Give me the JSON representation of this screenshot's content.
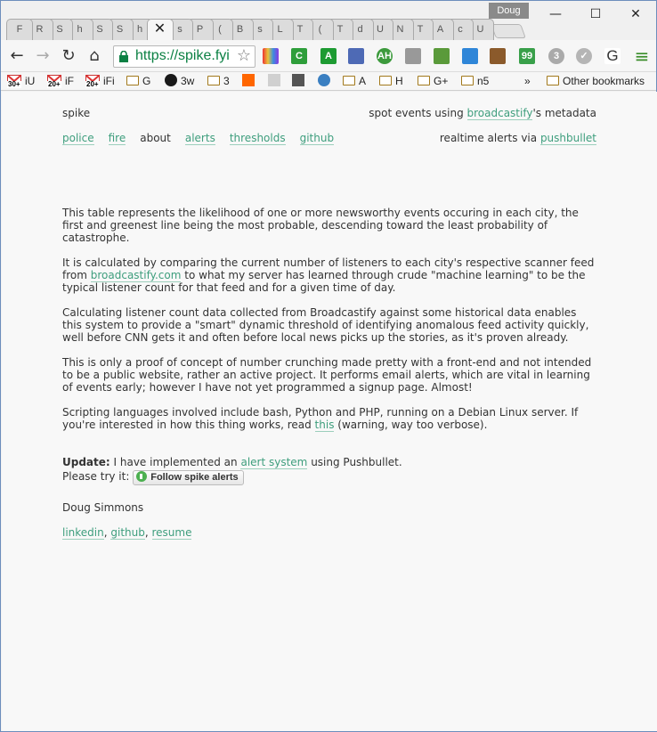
{
  "window": {
    "profile": "Doug",
    "minimize": "—",
    "maximize": "☐",
    "close": "✕"
  },
  "tabs": [
    {
      "label": "F"
    },
    {
      "label": "R"
    },
    {
      "label": "S"
    },
    {
      "label": "h"
    },
    {
      "label": "S"
    },
    {
      "label": "S"
    },
    {
      "label": "h"
    },
    {
      "label": "✕",
      "active": true
    },
    {
      "label": "s"
    },
    {
      "label": "P"
    },
    {
      "label": "("
    },
    {
      "label": "B"
    },
    {
      "label": "s"
    },
    {
      "label": "L"
    },
    {
      "label": "T"
    },
    {
      "label": "("
    },
    {
      "label": "T"
    },
    {
      "label": "d"
    },
    {
      "label": "U"
    },
    {
      "label": "N"
    },
    {
      "label": "T"
    },
    {
      "label": "A"
    },
    {
      "label": "c"
    },
    {
      "label": "U"
    }
  ],
  "toolbar": {
    "back": "←",
    "forward": "→",
    "reload": "↻",
    "home": "⌂",
    "url": "https://spike.fyi",
    "star": "☆",
    "menu": "≡"
  },
  "extensions": [
    {
      "icon": "colorpicker-icon",
      "text": "",
      "color": "#c04a9a"
    },
    {
      "icon": "refresh-green-icon",
      "text": "C",
      "color": "#2e9e3a"
    },
    {
      "icon": "a-green-icon",
      "text": "A",
      "color": "#1d9b32"
    },
    {
      "icon": "flag-icon",
      "text": "",
      "color": "#4e6ab5"
    },
    {
      "icon": "ah-icon",
      "text": "AH",
      "color": "#3c9a3c"
    },
    {
      "icon": "rss-icon",
      "text": "",
      "color": "#999999"
    },
    {
      "icon": "evernote-icon",
      "text": "",
      "color": "#5a9a3a"
    },
    {
      "icon": "drive-icon",
      "text": "",
      "color": "#2f86d8"
    },
    {
      "icon": "monkey-icon",
      "text": "",
      "color": "#8b5a2b"
    },
    {
      "icon": "quote-icon",
      "text": "99",
      "color": "#39a04a"
    },
    {
      "icon": "circle3-icon",
      "text": "3",
      "color": "#aaaaaa"
    },
    {
      "icon": "check-circle-icon",
      "text": "✓",
      "color": "#b5b5b5"
    },
    {
      "icon": "google-g-icon",
      "text": "G",
      "color": "#ffffff"
    }
  ],
  "bookmarks": [
    {
      "label": "iU",
      "icon": "gmail-icon",
      "badge": "30+"
    },
    {
      "label": "iF",
      "icon": "gmail-icon",
      "badge": "20+"
    },
    {
      "label": "iFi",
      "icon": "gmail-icon",
      "badge": "20+"
    },
    {
      "label": "G",
      "icon": "folder-icon"
    },
    {
      "label": "3w",
      "icon": "spiral-icon"
    },
    {
      "label": "3",
      "icon": "folder-icon"
    },
    {
      "label": "",
      "icon": "hn-icon"
    },
    {
      "label": "",
      "icon": "news-icon"
    },
    {
      "label": "",
      "icon": "book-icon"
    },
    {
      "label": "",
      "icon": "signal-icon"
    },
    {
      "label": "A",
      "icon": "folder-icon"
    },
    {
      "label": "H",
      "icon": "folder-icon"
    },
    {
      "label": "G+",
      "icon": "folder-icon"
    },
    {
      "label": "n5",
      "icon": "folder-icon"
    }
  ],
  "bookmarks_more": "»",
  "other_bookmarks": "Other bookmarks",
  "site": {
    "brand": "spike",
    "tagline_pre": "spot events using ",
    "tagline_link": "broadcastify",
    "tagline_post": "'s metadata",
    "nav": [
      {
        "label": "police",
        "link": true
      },
      {
        "label": "fire",
        "link": true
      },
      {
        "label": "about",
        "link": false
      },
      {
        "label": "alerts",
        "link": true
      },
      {
        "label": "thresholds",
        "link": true
      },
      {
        "label": "github",
        "link": true
      }
    ],
    "realtime_pre": "realtime alerts via ",
    "realtime_link": "pushbullet"
  },
  "content": {
    "p1": "This table represents the likelihood of one or more newsworthy events occuring in each city, the first and greenest line being the most probable, descending toward the least probability of catastrophe.",
    "p2_pre": "It is calculated by comparing the current number of listeners to each city's respective scanner feed from ",
    "p2_link": "broadcastify.com",
    "p2_post": " to what my server has learned through crude \"machine learning\" to be the typical listener count for that feed and for a given time of day.",
    "p3": "Calculating listener count data collected from Broadcastify against some historical data enables this system to provide a \"smart\" dynamic threshold of identifying anomalous feed activity quickly, well before CNN gets it and often before local news picks up the stories, as it's proven already.",
    "p4": "This is only a proof of concept of number crunching made pretty with a front-end and not intended to be a public website, rather an active project. It performs email alerts, which are vital in learning of events early; however I have not yet programmed a signup page. Almost!",
    "p5_pre": "Scripting languages involved include bash, Python and PHP, running on a Debian Linux server. If you're interested in how this thing works, read ",
    "p5_link": "this",
    "p5_post": " (warning, way too verbose).",
    "update_label": "Update:",
    "update_pre": " I have implemented an ",
    "update_link": "alert system",
    "update_post": " using Pushbullet.",
    "try_label": "Please try it:",
    "follow_button": "Follow spike alerts",
    "author": "Doug Simmons",
    "social": [
      {
        "label": "linkedin"
      },
      {
        "label": "github"
      },
      {
        "label": "resume"
      }
    ],
    "social_sep": ", "
  }
}
